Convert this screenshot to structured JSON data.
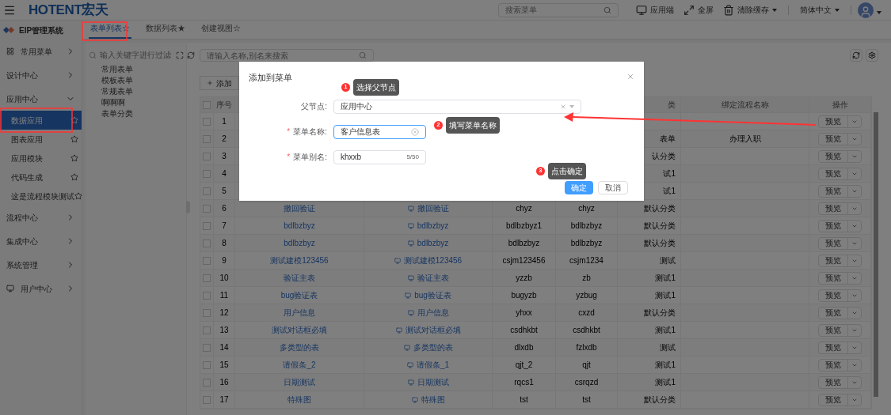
{
  "header": {
    "logo": "HOTENT宏天",
    "search_placeholder": "搜索菜单",
    "actions": [
      {
        "kind": "monitor",
        "label": "应用端",
        "dropdown": false
      },
      {
        "kind": "fullscreen",
        "label": "全屏",
        "dropdown": false
      },
      {
        "kind": "broom",
        "label": "清除缓存",
        "dropdown": true
      },
      {
        "kind": "language",
        "label": "简体中文",
        "dropdown": true
      }
    ]
  },
  "sidebar": {
    "title": "EIP管理系统",
    "items": [
      {
        "label": "常用菜单",
        "kind": "grid",
        "expanded": false
      },
      {
        "label": "设计中心",
        "kind": "plain",
        "expanded": false
      },
      {
        "label": "应用中心",
        "kind": "plain",
        "expanded": true,
        "children": [
          {
            "label": "数据应用",
            "selected": true
          },
          {
            "label": "图表应用",
            "selected": false
          },
          {
            "label": "应用模块",
            "selected": false
          },
          {
            "label": "代码生成",
            "selected": false
          },
          {
            "label": "这是流程模块测试",
            "selected": false
          }
        ]
      },
      {
        "label": "流程中心",
        "kind": "plain",
        "expanded": false
      },
      {
        "label": "集成中心",
        "kind": "plain",
        "expanded": false
      },
      {
        "label": "系统管理",
        "kind": "plain",
        "expanded": false
      },
      {
        "label": "用户中心",
        "kind": "monitor",
        "expanded": false
      }
    ]
  },
  "tabs": [
    {
      "label": "表单列表☆",
      "selected": true
    },
    {
      "label": "数据列表★",
      "selected": false
    },
    {
      "label": "创建视图☆",
      "selected": false
    }
  ],
  "tree": {
    "placeholder": "输入关键字进行过滤",
    "items": [
      "常用表单",
      "模板表单",
      "常规表单",
      "啊啊啊",
      "表单分类"
    ]
  },
  "main": {
    "search_placeholder": "请输入名称,别名来搜索",
    "add_button": "添加",
    "all_checked": false,
    "columns": [
      "序号",
      "",
      "",
      "",
      "",
      "类",
      "绑定流程名称",
      "操作"
    ],
    "rows": [
      {
        "checked": false,
        "no": "1",
        "name": "",
        "object": "",
        "code": "",
        "alias": "",
        "category": "",
        "flow": "",
        "action": "预览"
      },
      {
        "checked": false,
        "no": "2",
        "name": "",
        "object": "",
        "code": "",
        "alias": "",
        "category": "表单",
        "flow": "办理入职",
        "action": "预览"
      },
      {
        "checked": false,
        "no": "3",
        "name": "",
        "object": "",
        "code": "",
        "alias": "",
        "category": "认分类",
        "flow": "",
        "action": "预览"
      },
      {
        "checked": false,
        "no": "4",
        "name": "",
        "object": "",
        "code": "",
        "alias": "",
        "category": "试1",
        "flow": "",
        "action": "预览"
      },
      {
        "checked": false,
        "no": "5",
        "name": "",
        "object": "",
        "code": "",
        "alias": "",
        "category": "试1",
        "flow": "",
        "action": "预览"
      },
      {
        "checked": false,
        "no": "6",
        "name": "撤回验证",
        "object": "撤回验证",
        "code": "chyz",
        "alias": "chyz",
        "category": "默认分类",
        "flow": "",
        "action": "预览"
      },
      {
        "checked": false,
        "no": "7",
        "name": "bdlbzbyz",
        "object": "bdlbzbyz",
        "code": "bdlbzbyz1",
        "alias": "bdlbzbyz",
        "category": "默认分类",
        "flow": "",
        "action": "预览"
      },
      {
        "checked": false,
        "no": "8",
        "name": "bdlbzbyz",
        "object": "bdlbzbyz",
        "code": "bdlbzbyz",
        "alias": "bdlbzbyz",
        "category": "默认分类",
        "flow": "",
        "action": "预览"
      },
      {
        "checked": false,
        "no": "9",
        "name": "测试建模123456",
        "object": "测试建模123456",
        "code": "csjm123456",
        "alias": "csjm1234",
        "category": "测试",
        "flow": "",
        "action": "预览"
      },
      {
        "checked": false,
        "no": "10",
        "name": "验证主表",
        "object": "验证主表",
        "code": "yzzb",
        "alias": "zb",
        "category": "测试1",
        "flow": "",
        "action": "预览"
      },
      {
        "checked": false,
        "no": "11",
        "name": "bug验证表",
        "object": "bug验证表",
        "code": "bugyzb",
        "alias": "yzbug",
        "category": "测试1",
        "flow": "",
        "action": "预览"
      },
      {
        "checked": false,
        "no": "12",
        "name": "用户信息",
        "object": "用户信息",
        "code": "yhxx",
        "alias": "cxzd",
        "category": "默认分类",
        "flow": "",
        "action": "预览"
      },
      {
        "checked": false,
        "no": "13",
        "name": "测试对话框必填",
        "object": "测试对话框必填",
        "code": "csdhkbt",
        "alias": "csdhkbt",
        "category": "测试1",
        "flow": "",
        "action": "预览"
      },
      {
        "checked": false,
        "no": "14",
        "name": "多类型的表",
        "object": "多类型的表",
        "code": "dlxdb",
        "alias": "fzlxdb",
        "category": "测试",
        "flow": "",
        "action": "预览"
      },
      {
        "checked": false,
        "no": "15",
        "name": "请假条_2",
        "object": "请假条_1",
        "code": "qjt_2",
        "alias": "qjt",
        "category": "测试1",
        "flow": "",
        "action": "预览"
      },
      {
        "checked": false,
        "no": "16",
        "name": "日期测试",
        "object": "日期测试",
        "code": "rqcs1",
        "alias": "csrqzd",
        "category": "测试1",
        "flow": "",
        "action": "预览"
      },
      {
        "checked": false,
        "no": "17",
        "name": "特殊图",
        "object": "特殊图",
        "code": "tst",
        "alias": "tst",
        "category": "默认分类",
        "flow": "",
        "action": "预览"
      }
    ]
  },
  "dialog": {
    "title": "添加到菜单",
    "fields": [
      {
        "label": "父节点:",
        "value": "应用中心",
        "kind": "select",
        "focused": false
      },
      {
        "asterisk": "*",
        "label": "菜单名称:",
        "value": "客户信息表",
        "kind": "clearable",
        "focused": true
      },
      {
        "asterisk": "*",
        "label": "菜单别名:",
        "value": "khxxb",
        "count": "5/50",
        "kind": "counter",
        "focused": false
      }
    ],
    "confirm": "确定",
    "cancel": "取消"
  },
  "annotations": [
    {
      "number": "1",
      "text": "选择父节点"
    },
    {
      "number": "2",
      "text": "填写菜单名称"
    },
    {
      "number": "3",
      "text": "点击确定"
    }
  ]
}
